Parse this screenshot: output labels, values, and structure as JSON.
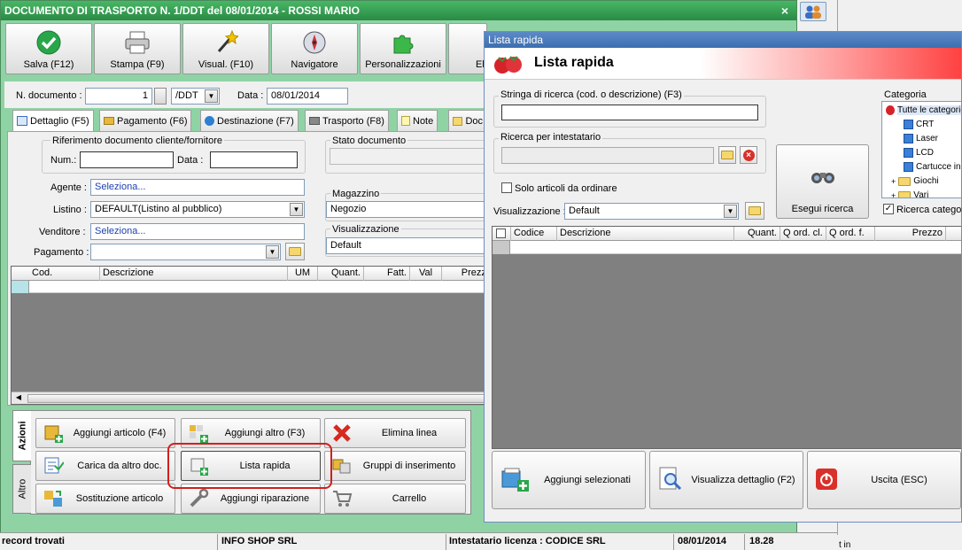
{
  "main_window": {
    "title": "DOCUMENTO DI TRASPORTO N. 1/DDT del 08/01/2014 - ROSSI MARIO",
    "close_glyph": "×",
    "toolbar": [
      {
        "label": "Salva (F12)",
        "icon": "save-check-icon"
      },
      {
        "label": "Stampa (F9)",
        "icon": "printer-icon"
      },
      {
        "label": "Visual. (F10)",
        "icon": "magic-wand-icon"
      },
      {
        "label": "Navigatore",
        "icon": "compass-icon"
      },
      {
        "label": "Personalizzazioni",
        "icon": "puzzle-icon"
      },
      {
        "label": "El",
        "icon": "delete-icon"
      }
    ],
    "doc_number_label": "N. documento :",
    "doc_number": "1",
    "doc_series": "/DDT",
    "date_label": "Data :",
    "date": "08/01/2014",
    "tabs": [
      {
        "label": "Dettaglio (F5)"
      },
      {
        "label": "Pagamento (F6)"
      },
      {
        "label": "Destinazione (F7)"
      },
      {
        "label": "Trasporto (F8)"
      },
      {
        "label": "Note"
      },
      {
        "label": "Doc"
      }
    ],
    "ref_group_label": "Riferimento documento cliente/fornitore",
    "num_label": "Num.:",
    "data_label": "Data :",
    "stato_label": "Stato documento",
    "agente_label": "Agente :",
    "agente_value": "Seleziona...",
    "listino_label": "Listino :",
    "listino_value": "DEFAULT(Listino al pubblico)",
    "venditore_label": "Venditore :",
    "venditore_value": "Seleziona...",
    "pagamento_label": "Pagamento :",
    "magazzino_label": "Magazzino",
    "magazzino_value": "Negozio",
    "visualizzazione_label": "Visualizzazione",
    "visualizzazione_value": "Default",
    "grid_headers": [
      "Cod.",
      "Descrizione",
      "UM",
      "Quant.",
      "Fatt.",
      "Val",
      "Prezzo"
    ],
    "side_tabs": [
      "Azioni",
      "Altro"
    ],
    "actions": [
      {
        "label": "Aggiungi articolo (F4)",
        "icon": "add-article-icon"
      },
      {
        "label": "Aggiungi altro (F3)",
        "icon": "add-other-icon"
      },
      {
        "label": "Elimina linea",
        "icon": "delete-line-icon"
      },
      {
        "label": "Carica da altro doc.",
        "icon": "load-doc-icon"
      },
      {
        "label": "Lista rapida",
        "icon": "quick-list-icon"
      },
      {
        "label": "Gruppi di inserimento",
        "icon": "groups-icon"
      },
      {
        "label": "Sostituzione articolo",
        "icon": "replace-article-icon"
      },
      {
        "label": "Aggiungi riparazione",
        "icon": "repair-icon"
      },
      {
        "label": "Carrello",
        "icon": "cart-icon"
      }
    ]
  },
  "status_bar": {
    "records": "record trovati",
    "company": "INFO SHOP SRL",
    "license": "Intestatario licenza : CODICE SRL",
    "date": "08/01/2014",
    "time": "18.28",
    "right_fragment": "t in"
  },
  "popup": {
    "window_title": "Lista rapida",
    "header_title": "Lista rapida",
    "search_label": "Stringa di ricerca (cod. o descrizione) (F3)",
    "search_value": "",
    "owner_label": "Ricerca per intestatario",
    "only_order_label": "Solo articoli da ordinare",
    "view_label": "Visualizzazione :",
    "view_value": "Default",
    "search_button": "Esegui ricerca",
    "category_label": "Categoria",
    "categories": [
      {
        "label": "Tutte le categorie"
      },
      {
        "label": "CRT"
      },
      {
        "label": "Laser"
      },
      {
        "label": "LCD"
      },
      {
        "label": "Cartucce ink"
      },
      {
        "label": "Giochi"
      },
      {
        "label": "Vari"
      }
    ],
    "category_search_label": "Ricerca categorie",
    "grid_headers": [
      "Codice",
      "Descrizione",
      "Quant.",
      "Q ord. cl.",
      "Q ord. f.",
      "Prezzo"
    ],
    "buttons": [
      {
        "label": "Aggiungi selezionati",
        "icon": "add-selected-icon"
      },
      {
        "label": "Visualizza dettaglio (F2)",
        "icon": "magnifier-icon"
      },
      {
        "label": "Uscita (ESC)",
        "icon": "power-icon"
      }
    ]
  },
  "colors": {
    "titlebar": "#2e9a4a",
    "main_bg": "#8fd3a5",
    "highlight": "#d11f1f",
    "popup_title": "#3c6fb0"
  }
}
